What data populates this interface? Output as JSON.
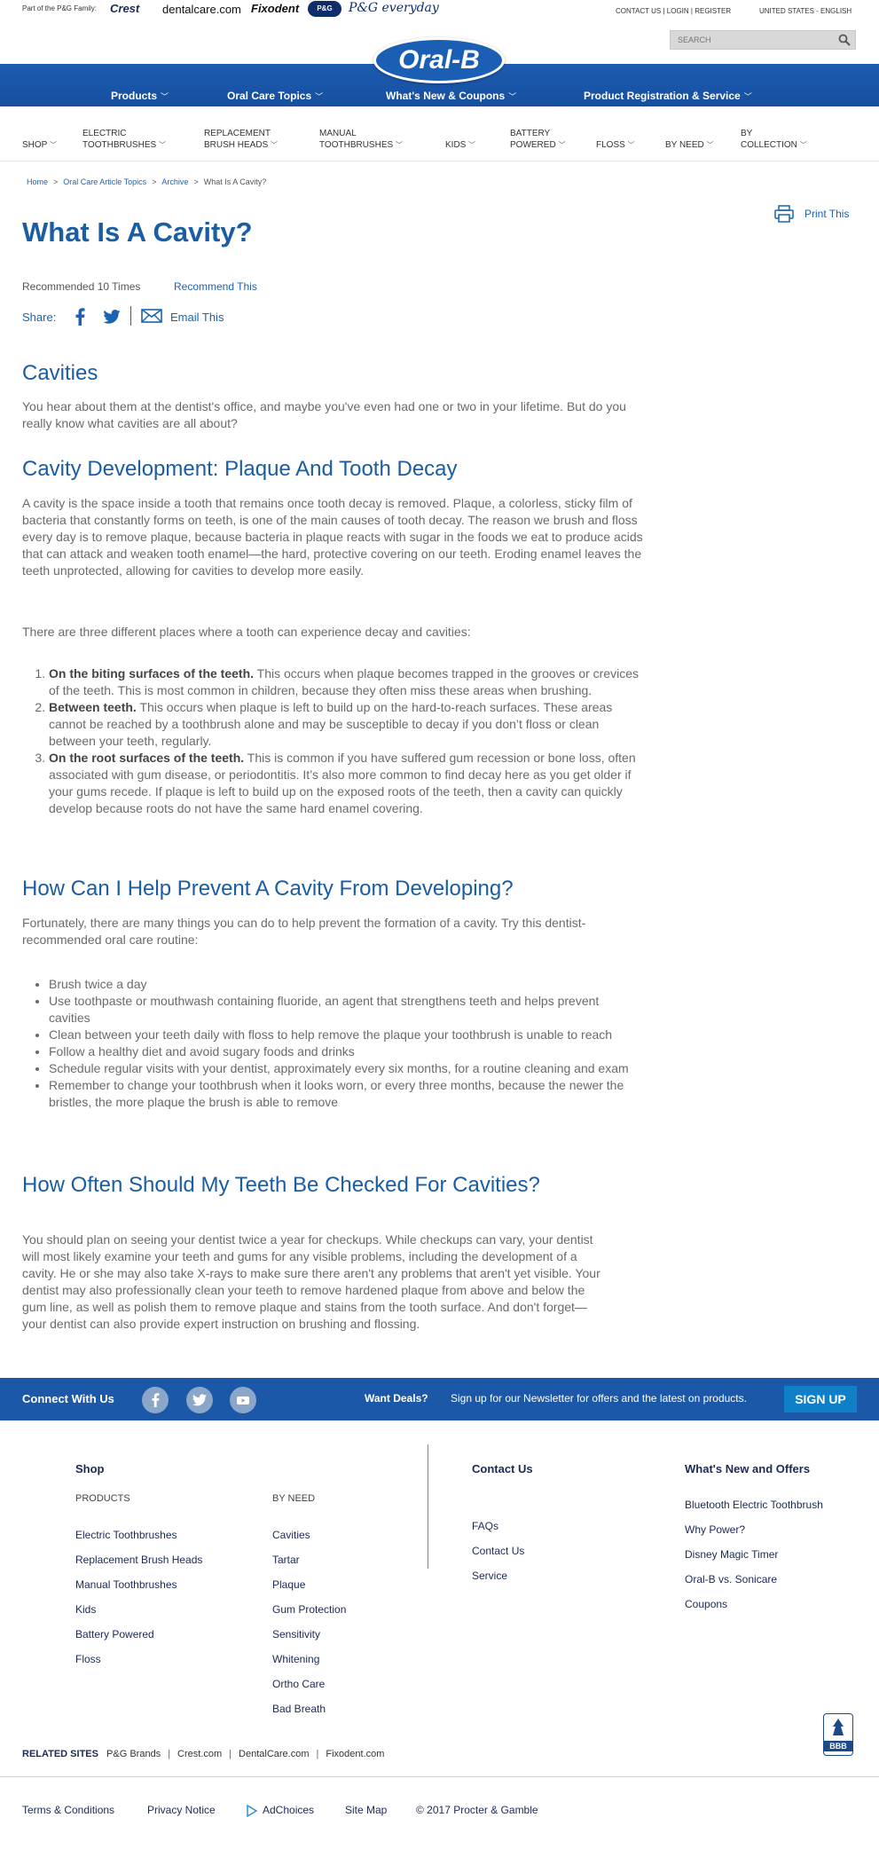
{
  "topbar": {
    "pg_family": "Part of the P&G Family:",
    "brands": [
      "Crest",
      "dentalcare.com",
      "Fixodent",
      "P&G Shop",
      "P&G everyday"
    ],
    "util_links": "CONTACT US | LOGIN | REGISTER",
    "country": "UNITED STATES - ENGLISH",
    "search_placeholder": "SEARCH"
  },
  "logo": "Oral-B",
  "main_nav": [
    {
      "label": "Products"
    },
    {
      "label": "Oral Care Topics"
    },
    {
      "label": "What's New & Coupons"
    },
    {
      "label": "Product Registration & Service"
    }
  ],
  "cat_nav": [
    {
      "line1": "SHOP",
      "line2": ""
    },
    {
      "line1": "ELECTRIC",
      "line2": "TOOTHBRUSHES"
    },
    {
      "line1": "REPLACEMENT",
      "line2": "BRUSH HEADS"
    },
    {
      "line1": "MANUAL",
      "line2": "TOOTHBRUSHES"
    },
    {
      "line1": "KIDS",
      "line2": ""
    },
    {
      "line1": "BATTERY",
      "line2": "POWERED"
    },
    {
      "line1": "FLOSS",
      "line2": ""
    },
    {
      "line1": "BY NEED",
      "line2": ""
    },
    {
      "line1": "BY",
      "line2": "COLLECTION"
    }
  ],
  "breadcrumb": {
    "items": [
      "Home",
      "Oral Care Article Topics",
      "Archive"
    ],
    "current": "What Is A Cavity?"
  },
  "print_label": "Print This",
  "article": {
    "title": "What Is A Cavity?",
    "recommended": "Recommended 10 Times",
    "recommend_link": "Recommend This",
    "share_label": "Share:",
    "email_label": "Email This",
    "h_cavities": "Cavities",
    "p_intro": "You hear about them at the dentist's office, and maybe you've even had one or two in your lifetime. But do you really know what cavities are all about?",
    "h_development": "Cavity Development: Plaque And Tooth Decay",
    "p_development": "A cavity is the space inside a tooth that remains once tooth decay is removed. Plaque, a colorless, sticky film of bacteria that constantly forms on teeth, is one of the main causes of tooth decay. The reason we brush and floss every day is to remove plaque, because bacteria in plaque reacts with sugar in the foods we eat to produce acids that can attack and weaken tooth enamel—the hard, protective covering on our teeth. Eroding enamel leaves the teeth unprotected, allowing for cavities to develop more easily.",
    "p_three_places": "There are three different places where a tooth can experience decay and cavities:",
    "places": [
      {
        "bold": "On the biting surfaces of the teeth.",
        "text": " This occurs when plaque becomes trapped in the grooves or crevices of the teeth. This is most common in children, because they often miss these areas when brushing."
      },
      {
        "bold": "Between teeth.",
        "text": " This occurs when plaque is left to build up on the hard-to-reach surfaces. These areas cannot be reached by a toothbrush alone and may be susceptible to decay if you don’t floss or clean between your teeth, regularly."
      },
      {
        "bold": "On the root surfaces of the teeth.",
        "text": " This is common if you have suffered gum recession or bone loss, often associated with gum disease, or periodontitis. It’s also more common to find decay here as you get older if your gums recede. If plaque is left to build up on the exposed roots of the teeth, then a cavity can quickly develop because roots do not have the same hard enamel covering."
      }
    ],
    "h_prevent": "How Can I Help Prevent A Cavity From Developing?",
    "p_prevent": "Fortunately, there are many things you can do to help prevent the formation of a cavity. Try this dentist-recommended oral care routine:",
    "routine": [
      "Brush twice a day",
      "Use toothpaste or mouthwash containing fluoride, an agent that strengthens teeth and helps prevent cavities",
      "Clean between your teeth daily with floss to help remove the plaque your toothbrush is unable to reach",
      "Follow a healthy diet and avoid sugary foods and drinks",
      "Schedule regular visits with your dentist, approximately every six months, for a routine cleaning and exam",
      "Remember to change your toothbrush when it looks worn, or every three months, because the newer the bristles, the more plaque the brush is able to remove"
    ],
    "h_checked": "How Often Should My Teeth Be Checked For Cavities?",
    "p_checked": "You should plan on seeing your dentist twice a year for checkups. While checkups can vary, your dentist will most likely examine your teeth and gums for any visible problems, including the development of a cavity. He or she may also take X-rays to make sure there aren't any problems that aren't yet visible. Your dentist may also professionally clean your teeth to remove hardened plaque from above and below the gum line, as well as polish them to remove plaque and stains from the tooth surface. And don't forget—your dentist can also provide expert instruction on brushing and flossing."
  },
  "connect": {
    "label": "Connect With Us",
    "deals": "Want Deals?",
    "deals_text": "Sign up for our Newsletter for offers and the latest on products.",
    "signup": "SIGN UP"
  },
  "footer": {
    "shop_title": "Shop",
    "products_label": "PRODUCTS",
    "products": [
      "Electric Toothbrushes",
      "Replacement Brush Heads",
      "Manual Toothbrushes",
      "Kids",
      "Battery Powered",
      "Floss"
    ],
    "by_need_label": "BY NEED",
    "by_need": [
      "Cavities",
      "Tartar",
      "Plaque",
      "Gum Protection",
      "Sensitivity",
      "Whitening",
      "Ortho Care",
      "Bad Breath"
    ],
    "contact_title": "Contact Us",
    "contact": [
      "FAQs",
      "Contact Us",
      "Service"
    ],
    "offers_title": "What's New and Offers",
    "offers": [
      "Bluetooth Electric Toothbrush",
      "Why Power?",
      "Disney Magic Timer",
      "Oral-B vs. Sonicare",
      "Coupons"
    ],
    "related_label": "RELATED SITES",
    "related": [
      "P&G Brands",
      "Crest.com",
      "DentalCare.com",
      "Fixodent.com"
    ],
    "bbb": "BBB",
    "bottom": [
      "Terms & Conditions",
      "Privacy Notice",
      "AdChoices",
      "Site Map",
      "© 2017 Procter & Gamble"
    ]
  },
  "colors": {
    "brand_blue": "#1b58a8",
    "heading_blue": "#1a5da3",
    "link_blue": "#1a63b2",
    "signup_blue": "#0f7fc8"
  }
}
